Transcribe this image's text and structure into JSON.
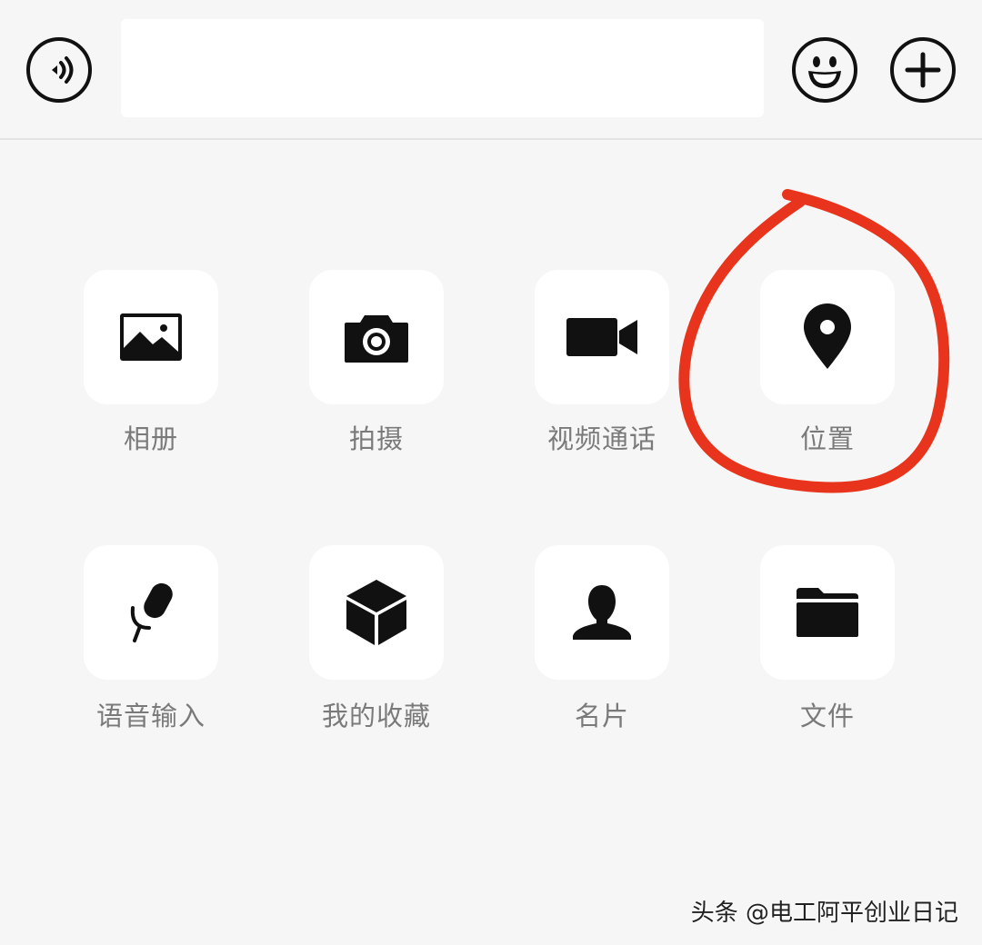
{
  "input_bar": {
    "text_value": "",
    "voice_icon": "voice-icon",
    "emoji_icon": "emoji-icon",
    "plus_icon": "plus-icon"
  },
  "panel": {
    "items": [
      {
        "label": "相册",
        "icon": "photo-icon"
      },
      {
        "label": "拍摄",
        "icon": "camera-icon"
      },
      {
        "label": "视频通话",
        "icon": "video-call-icon"
      },
      {
        "label": "位置",
        "icon": "location-icon"
      },
      {
        "label": "语音输入",
        "icon": "microphone-icon"
      },
      {
        "label": "我的收藏",
        "icon": "favorites-box-icon"
      },
      {
        "label": "名片",
        "icon": "contact-card-icon"
      },
      {
        "label": "文件",
        "icon": "folder-icon"
      }
    ]
  },
  "annotation": {
    "color": "#e8341c",
    "shape": "hand-drawn circle around 位置"
  },
  "watermark": {
    "text": "头条 @电工阿平创业日记"
  },
  "colors": {
    "background": "#f6f6f6",
    "tile": "#ffffff",
    "icon": "#111111",
    "label": "#7a7a7a"
  }
}
